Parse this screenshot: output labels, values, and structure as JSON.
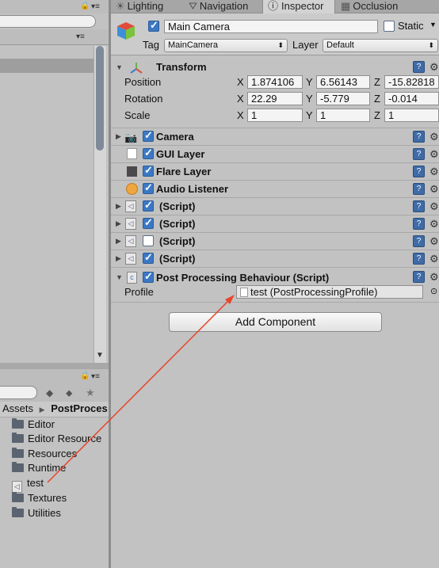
{
  "tabs": [
    "Lighting",
    "Navigation",
    "Inspector",
    "Occlusion"
  ],
  "game_object": {
    "active": true,
    "name": "Main Camera",
    "static_label": "Static",
    "tag_label": "Tag",
    "tag_value": "MainCamera",
    "layer_label": "Layer",
    "layer_value": "Default"
  },
  "transform": {
    "title": "Transform",
    "rows": [
      {
        "label": "Position",
        "x": "1.874106",
        "y": "6.56143",
        "z": "-15.82818"
      },
      {
        "label": "Rotation",
        "x": "22.29",
        "y": "-5.779",
        "z": "-0.014"
      },
      {
        "label": "Scale",
        "x": "1",
        "y": "1",
        "z": "1"
      }
    ],
    "axis_x": "X",
    "axis_y": "Y",
    "axis_z": "Z"
  },
  "components": [
    {
      "title": "Camera",
      "enabled": true,
      "icon": "camera-icon"
    },
    {
      "title": "GUI Layer",
      "enabled": true,
      "icon": "gui-layer-icon"
    },
    {
      "title": "Flare Layer",
      "enabled": true,
      "icon": "flare-layer-icon"
    },
    {
      "title": "Audio Listener",
      "enabled": true,
      "icon": "audio-listener-icon"
    },
    {
      "title": "(Script)",
      "enabled": true,
      "icon": "script-icon"
    },
    {
      "title": "(Script)",
      "enabled": true,
      "icon": "script-icon"
    },
    {
      "title": "(Script)",
      "enabled": false,
      "icon": "script-icon"
    },
    {
      "title": "(Script)",
      "enabled": true,
      "icon": "script-icon"
    }
  ],
  "post_processing": {
    "title": "Post Processing Behaviour (Script)",
    "profile_label": "Profile",
    "profile_value": "test (PostProcessingProfile)"
  },
  "add_component_label": "Add Component",
  "project": {
    "breadcrumb_root": "Assets",
    "breadcrumb_current": "PostProces",
    "items": [
      {
        "name": "Editor",
        "type": "folder"
      },
      {
        "name": "Editor Resource",
        "type": "folder"
      },
      {
        "name": "Resources",
        "type": "folder"
      },
      {
        "name": "Runtime",
        "type": "folder"
      },
      {
        "name": "test",
        "type": "asset"
      },
      {
        "name": "Textures",
        "type": "folder"
      },
      {
        "name": "Utilities",
        "type": "folder"
      }
    ]
  },
  "colors": {
    "accent": "#3b78c4",
    "annotation_arrow": "#e8452a"
  }
}
